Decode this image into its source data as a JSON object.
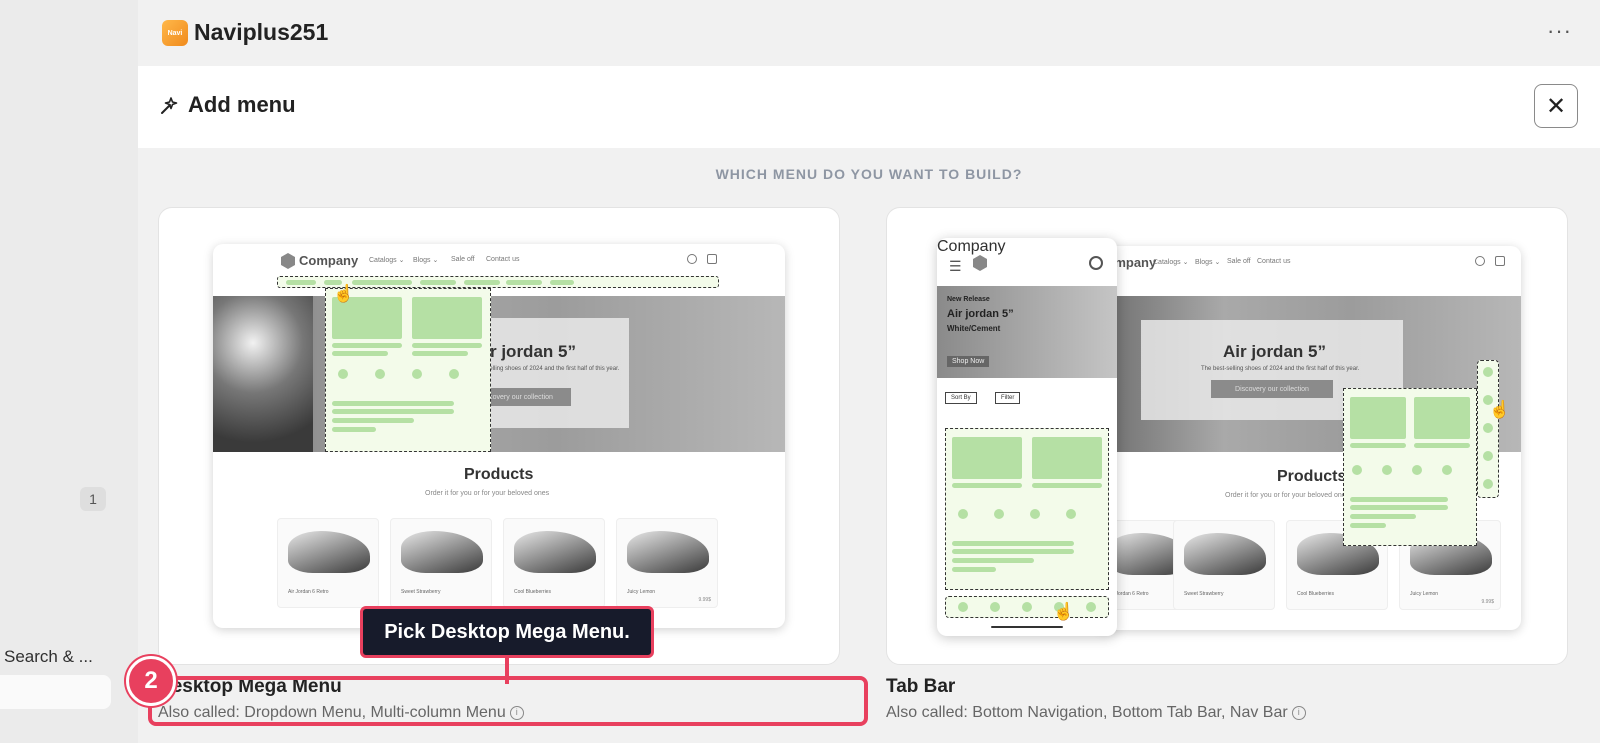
{
  "sidebar": {
    "badge": "1",
    "nav_label": "Search & ..."
  },
  "app": {
    "name": "Naviplus251",
    "logo_text": "Navi",
    "more_icon": "more-horizontal-icon"
  },
  "modal": {
    "title": "Add menu",
    "question": "WHICH MENU DO YOU WANT TO BUILD?",
    "close_icon": "close-icon"
  },
  "mockup": {
    "company": "Company",
    "nav": [
      "Catalogs ⌄",
      "Blogs ⌄",
      "Sale off",
      "Contact us"
    ],
    "hero_title_desktop": "Air jordan 5”",
    "hero_title_tabbar": "Air jordan 5”",
    "hero_sub": "The best-selling shoes of 2024 and the first half of this year.",
    "hero_button": "Discovery our collection",
    "products_title": "Products",
    "products_sub": "Order it for you or for your beloved ones",
    "products": [
      {
        "name": "Air Jordan 6 Retro",
        "price": ""
      },
      {
        "name": "Sweet Strawberry",
        "price": ""
      },
      {
        "name": "Cool Blueberries",
        "price": ""
      },
      {
        "name": "Juicy Lemon",
        "price": "9.99$"
      }
    ],
    "phone_new": "New Release",
    "phone_title": "Air jordan 5”",
    "phone_sub": "White/Cement",
    "phone_shop": "Shop Now",
    "phone_sort": "Sort By",
    "phone_filter": "Filter"
  },
  "options": [
    {
      "title": "Desktop Mega Menu",
      "subtitle": "Also called: Dropdown Menu, Multi-column Menu"
    },
    {
      "title": "Tab Bar",
      "subtitle": "Also called: Bottom Navigation, Bottom Tab Bar, Nav Bar"
    }
  ],
  "tutorial": {
    "tooltip": "Pick Desktop Mega Menu.",
    "step": "2"
  },
  "colors": {
    "accent": "#e8405e",
    "tooltip_bg": "#171b2b",
    "menu_green": "#b5e0a4"
  }
}
